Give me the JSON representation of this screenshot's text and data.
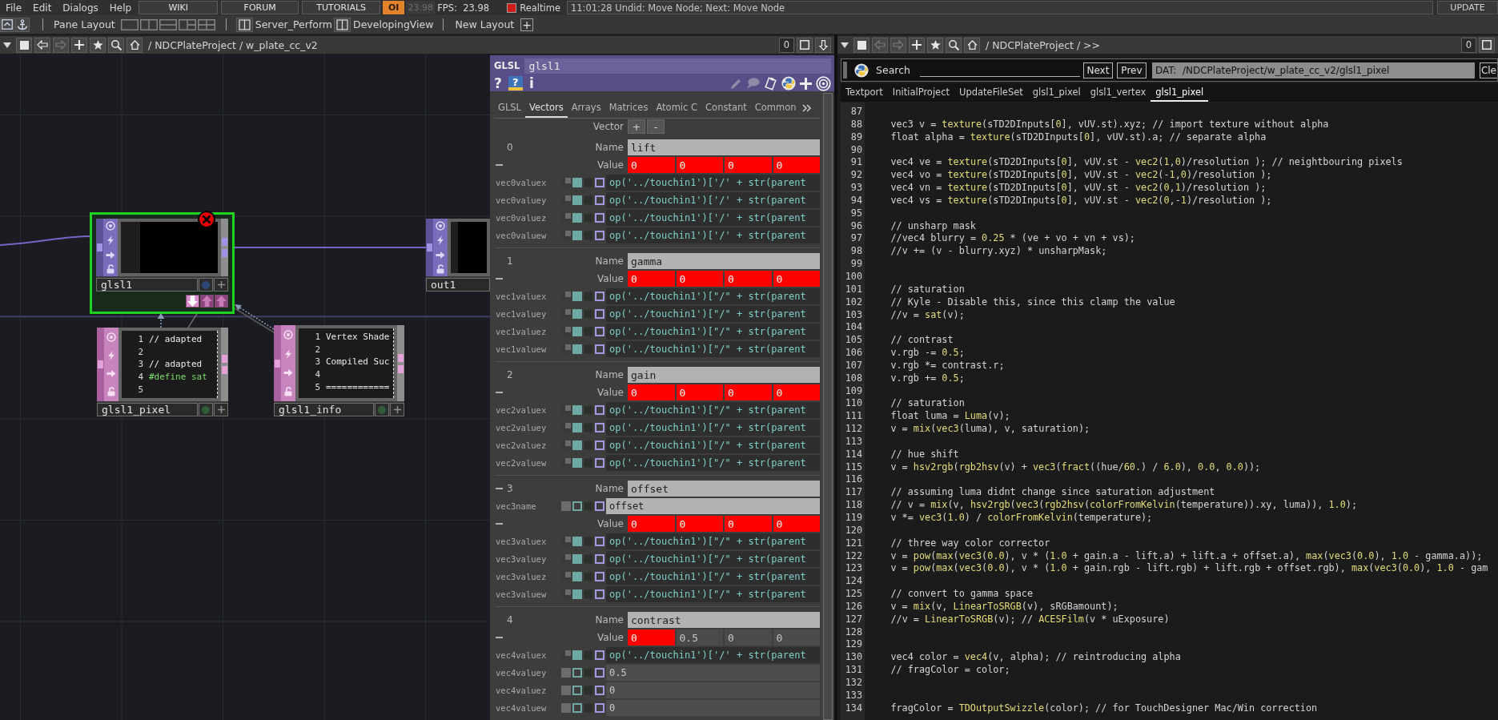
{
  "menu_bar": {
    "menus": [
      "File",
      "Edit",
      "Dialogs",
      "Help"
    ],
    "links": [
      "WIKI",
      "FORUM",
      "TUTORIALS"
    ],
    "perform_mode": "OI",
    "cook_rate": "23.98",
    "fps": "FPS:  23.98",
    "realtime": {
      "label": "Realtime",
      "on": true
    },
    "status": "11:01:28 Undid: Move Node; Next: Move Node",
    "update": "UPDATE"
  },
  "layout_bar": {
    "label": "Pane Layout",
    "saved_layouts": [
      "Server_Perform",
      "DevelopingView"
    ],
    "new_layout": "New Layout",
    "add": "+"
  },
  "network_pane": {
    "path": "/ NDCPlateProject / w_plate_cc_v2",
    "back_enabled": true,
    "forward_enabled": false,
    "counter": "0",
    "nodes": [
      {
        "kind": "top",
        "name": "glsl1",
        "selected": true,
        "error": true,
        "dock_buttons": true,
        "color": "#2d4676"
      },
      {
        "kind": "top",
        "name": "out1",
        "selected": false,
        "error": false,
        "dock_buttons": false
      },
      {
        "kind": "dat",
        "name": "glsl1_pixel",
        "selected": false,
        "error": false,
        "dock_buttons": false,
        "color": "#2f5c36",
        "lines": [
          {
            "number": "1",
            "kind": "text",
            "text": "// adapted"
          },
          {
            "number": "2"
          },
          {
            "number": "3",
            "kind": "text",
            "text": "// adapted"
          },
          {
            "number": "4",
            "kind": "directive",
            "text": "#define sat"
          },
          {
            "number": "5"
          }
        ]
      },
      {
        "kind": "dat",
        "name": "glsl1_info",
        "selected": false,
        "error": false,
        "dock_buttons": false,
        "color": "#2f5c36",
        "lines": [
          {
            "number": "1",
            "kind": "text",
            "text": "Vertex Shade"
          },
          {
            "number": "2"
          },
          {
            "number": "3",
            "kind": "text",
            "text": "Compiled Suc"
          },
          {
            "number": "4"
          },
          {
            "number": "5",
            "kind": "text",
            "text": "============"
          }
        ]
      }
    ]
  },
  "parameters": {
    "type": "GLSL",
    "name": "glsl1",
    "help": "?",
    "python_help": "?",
    "info": "i",
    "tabs": [
      {
        "label": "GLSL",
        "selected": false
      },
      {
        "label": "Vectors",
        "selected": true
      },
      {
        "label": "Arrays",
        "selected": false
      },
      {
        "label": "Matrices",
        "selected": false
      },
      {
        "label": "Atomic C",
        "selected": false
      },
      {
        "label": "Constant",
        "selected": false
      },
      {
        "label": "Common",
        "selected": false
      }
    ],
    "vector_label": "Vector",
    "add": "+",
    "remove": "-",
    "blocks": [
      {
        "index": "0",
        "name_expanded": false,
        "name_label": "Name",
        "name": "lift",
        "value_expanded": true,
        "value_label": "Value",
        "values": [
          {
            "text": "0",
            "error": true
          },
          {
            "text": "0",
            "error": true
          },
          {
            "text": "0",
            "error": true
          },
          {
            "text": "0",
            "error": true
          }
        ],
        "params": [
          {
            "label": "vec0valuex",
            "kind": "expression",
            "value": "op('../touchin1')['/' + str(parent"
          },
          {
            "label": "vec0valuey",
            "kind": "expression",
            "value": "op('../touchin1')['/' + str(parent"
          },
          {
            "label": "vec0valuez",
            "kind": "expression",
            "value": "op('../touchin1')['/' + str(parent"
          },
          {
            "label": "vec0valuew",
            "kind": "expression",
            "value": "op('../touchin1')['/' + str(parent"
          }
        ]
      },
      {
        "index": "1",
        "name_expanded": false,
        "name_label": "Name",
        "name": "gamma",
        "value_expanded": true,
        "value_label": "Value",
        "values": [
          {
            "text": "0",
            "error": true
          },
          {
            "text": "0",
            "error": true
          },
          {
            "text": "0",
            "error": true
          },
          {
            "text": "0",
            "error": true
          }
        ],
        "params": [
          {
            "label": "vec1valuex",
            "kind": "expression",
            "value": "op('../touchin1')[\"/\" + str(parent"
          },
          {
            "label": "vec1valuey",
            "kind": "expression",
            "value": "op('../touchin1')[\"/\" + str(parent"
          },
          {
            "label": "vec1valuez",
            "kind": "expression",
            "value": "op('../touchin1')[\"/\" + str(parent"
          },
          {
            "label": "vec1valuew",
            "kind": "expression",
            "value": "op('../touchin1')[\"/\" + str(parent"
          }
        ]
      },
      {
        "index": "2",
        "name_expanded": false,
        "name_label": "Name",
        "name": "gain",
        "value_expanded": true,
        "value_label": "Value",
        "values": [
          {
            "text": "0",
            "error": true
          },
          {
            "text": "0",
            "error": true
          },
          {
            "text": "0",
            "error": true
          },
          {
            "text": "0",
            "error": true
          }
        ],
        "params": [
          {
            "label": "vec2valuex",
            "kind": "expression",
            "value": "op('../touchin1')[\"/\" + str(parent"
          },
          {
            "label": "vec2valuey",
            "kind": "expression",
            "value": "op('../touchin1')[\"/\" + str(parent"
          },
          {
            "label": "vec2valuez",
            "kind": "expression",
            "value": "op('../touchin1')[\"/\" + str(parent"
          },
          {
            "label": "vec2valuew",
            "kind": "expression",
            "value": "op('../touchin1')[\"/\" + str(parent"
          }
        ]
      },
      {
        "index": "3",
        "name_expanded": true,
        "name_label": "Name",
        "name": "offset",
        "name_params": [
          {
            "label": "vec3name",
            "kind": "string",
            "value": "offset"
          }
        ],
        "value_expanded": true,
        "value_label": "Value",
        "values": [
          {
            "text": "0",
            "error": true
          },
          {
            "text": "0",
            "error": true
          },
          {
            "text": "0",
            "error": true
          },
          {
            "text": "0",
            "error": true
          }
        ],
        "params": [
          {
            "label": "vec3valuex",
            "kind": "expression",
            "value": "op('../touchin1')[\"/\" + str(parent"
          },
          {
            "label": "vec3valuey",
            "kind": "expression",
            "value": "op('../touchin1')[\"/\" + str(parent"
          },
          {
            "label": "vec3valuez",
            "kind": "expression",
            "value": "op('../touchin1')[\"/\" + str(parent"
          },
          {
            "label": "vec3valuew",
            "kind": "expression",
            "value": "op('../touchin1')[\"/\" + str(parent"
          }
        ]
      },
      {
        "index": "4",
        "name_expanded": false,
        "name_label": "Name",
        "name": "contrast",
        "value_expanded": true,
        "value_label": "Value",
        "values": [
          {
            "text": "0",
            "error": true
          },
          {
            "text": "0.5",
            "error": false
          },
          {
            "text": "0",
            "error": false
          },
          {
            "text": "0",
            "error": false
          }
        ],
        "params": [
          {
            "label": "vec4valuex",
            "kind": "expression",
            "value": "op('../touchin1')['/' + str(parent"
          },
          {
            "label": "vec4valuey",
            "kind": "number",
            "value": "0.5"
          },
          {
            "label": "vec4valuez",
            "kind": "number",
            "value": "0"
          },
          {
            "label": "vec4valuew",
            "kind": "number",
            "value": "0"
          }
        ]
      }
    ]
  },
  "text_pane": {
    "path": "/ NDCPlateProject / >>",
    "back_enabled": false,
    "forward_enabled": false,
    "counter": "0",
    "search_label": "Search",
    "next": "Next",
    "prev": "Prev",
    "dat_path": "DAT:  /NDCPlateProject/w_plate_cc_v2/glsl1_pixel",
    "clear": "Cle",
    "tabs": [
      {
        "label": "Textport",
        "selected": false
      },
      {
        "label": "InitialProject",
        "selected": false
      },
      {
        "label": "UpdateFileSet",
        "selected": false
      },
      {
        "label": "glsl1_pixel",
        "selected": false
      },
      {
        "label": "glsl1_vertex",
        "selected": false
      },
      {
        "label": "glsl1_pixel",
        "selected": true
      }
    ],
    "code": [
      {
        "number": "87"
      },
      {
        "number": "88",
        "text": "vec3 v = texture(sTD2DInputs[0], vUV.st).xyz; // import texture without alpha"
      },
      {
        "number": "89",
        "text": "float alpha = texture(sTD2DInputs[0], vUV.st).a; // separate alpha"
      },
      {
        "number": "90"
      },
      {
        "number": "91",
        "text": "vec4 ve = texture(sTD2DInputs[0], vUV.st - vec2(1,0)/resolution ); // neightbouring pixels"
      },
      {
        "number": "92",
        "text": "vec4 vo = texture(sTD2DInputs[0], vUV.st - vec2(-1,0)/resolution );"
      },
      {
        "number": "93",
        "text": "vec4 vn = texture(sTD2DInputs[0], vUV.st - vec2(0,1)/resolution );"
      },
      {
        "number": "94",
        "text": "vec4 vs = texture(sTD2DInputs[0], vUV.st - vec2(0,-1)/resolution );"
      },
      {
        "number": "95"
      },
      {
        "number": "96",
        "text": "// unsharp mask"
      },
      {
        "number": "97",
        "text": "//vec4 blurry = 0.25 * (ve + vo + vn + vs);"
      },
      {
        "number": "98",
        "text": "//v += (v - blurry.xyz) * unsharpMask;"
      },
      {
        "number": "99"
      },
      {
        "number": "100"
      },
      {
        "number": "101",
        "text": "// saturation"
      },
      {
        "number": "102",
        "text": "// Kyle - Disable this, since this clamp the value"
      },
      {
        "number": "103",
        "text": "//v = sat(v);"
      },
      {
        "number": "104"
      },
      {
        "number": "105",
        "text": "// contrast"
      },
      {
        "number": "106",
        "text": "v.rgb -= 0.5;"
      },
      {
        "number": "107",
        "text": "v.rgb *= contrast.r;"
      },
      {
        "number": "108",
        "text": "v.rgb += 0.5;"
      },
      {
        "number": "109"
      },
      {
        "number": "110",
        "text": "// saturation"
      },
      {
        "number": "111",
        "text": "float luma = Luma(v);"
      },
      {
        "number": "112",
        "text": "v = mix(vec3(luma), v, saturation);"
      },
      {
        "number": "113"
      },
      {
        "number": "114",
        "text": "// hue shift"
      },
      {
        "number": "115",
        "text": "v = hsv2rgb(rgb2hsv(v) + vec3(fract((hue/60.) / 6.0), 0.0, 0.0));"
      },
      {
        "number": "116"
      },
      {
        "number": "117",
        "text": "// assuming luma didnt change since saturation adjustment"
      },
      {
        "number": "118",
        "text": "// v = mix(v, hsv2rgb(vec3(rgb2hsv(colorFromKelvin(temperature)).xy, luma)), 1.0);"
      },
      {
        "number": "119",
        "text": "v *= vec3(1.0) / colorFromKelvin(temperature);"
      },
      {
        "number": "120"
      },
      {
        "number": "121",
        "text": "// three way color corrector"
      },
      {
        "number": "122",
        "text": "v = pow(max(vec3(0.0), v * (1.0 + gain.a - lift.a) + lift.a + offset.a), max(vec3(0.0), 1.0 - gamma.a));"
      },
      {
        "number": "123",
        "text": "v = pow(max(vec3(0.0), v * (1.0 + gain.rgb - lift.rgb) + lift.rgb + offset.rgb), max(vec3(0.0), 1.0 - gam"
      },
      {
        "number": "124"
      },
      {
        "number": "125",
        "text": "// convert to gamma space"
      },
      {
        "number": "126",
        "text": "v = mix(v, LinearToSRGB(v), sRGBamount);"
      },
      {
        "number": "127",
        "text": "//v = LinearToSRGB(v); // ACESFilm(v * uExposure)"
      },
      {
        "number": "128"
      },
      {
        "number": "129"
      },
      {
        "number": "130",
        "text": "vec4 color = vec4(v, alpha); // reintroducing alpha"
      },
      {
        "number": "131",
        "text": "// fragColor = color;"
      },
      {
        "number": "132"
      },
      {
        "number": "133"
      },
      {
        "number": "134",
        "text": "fragColor = TDOutputSwizzle(color); // for TouchDesigner Mac/Win correction"
      }
    ]
  }
}
